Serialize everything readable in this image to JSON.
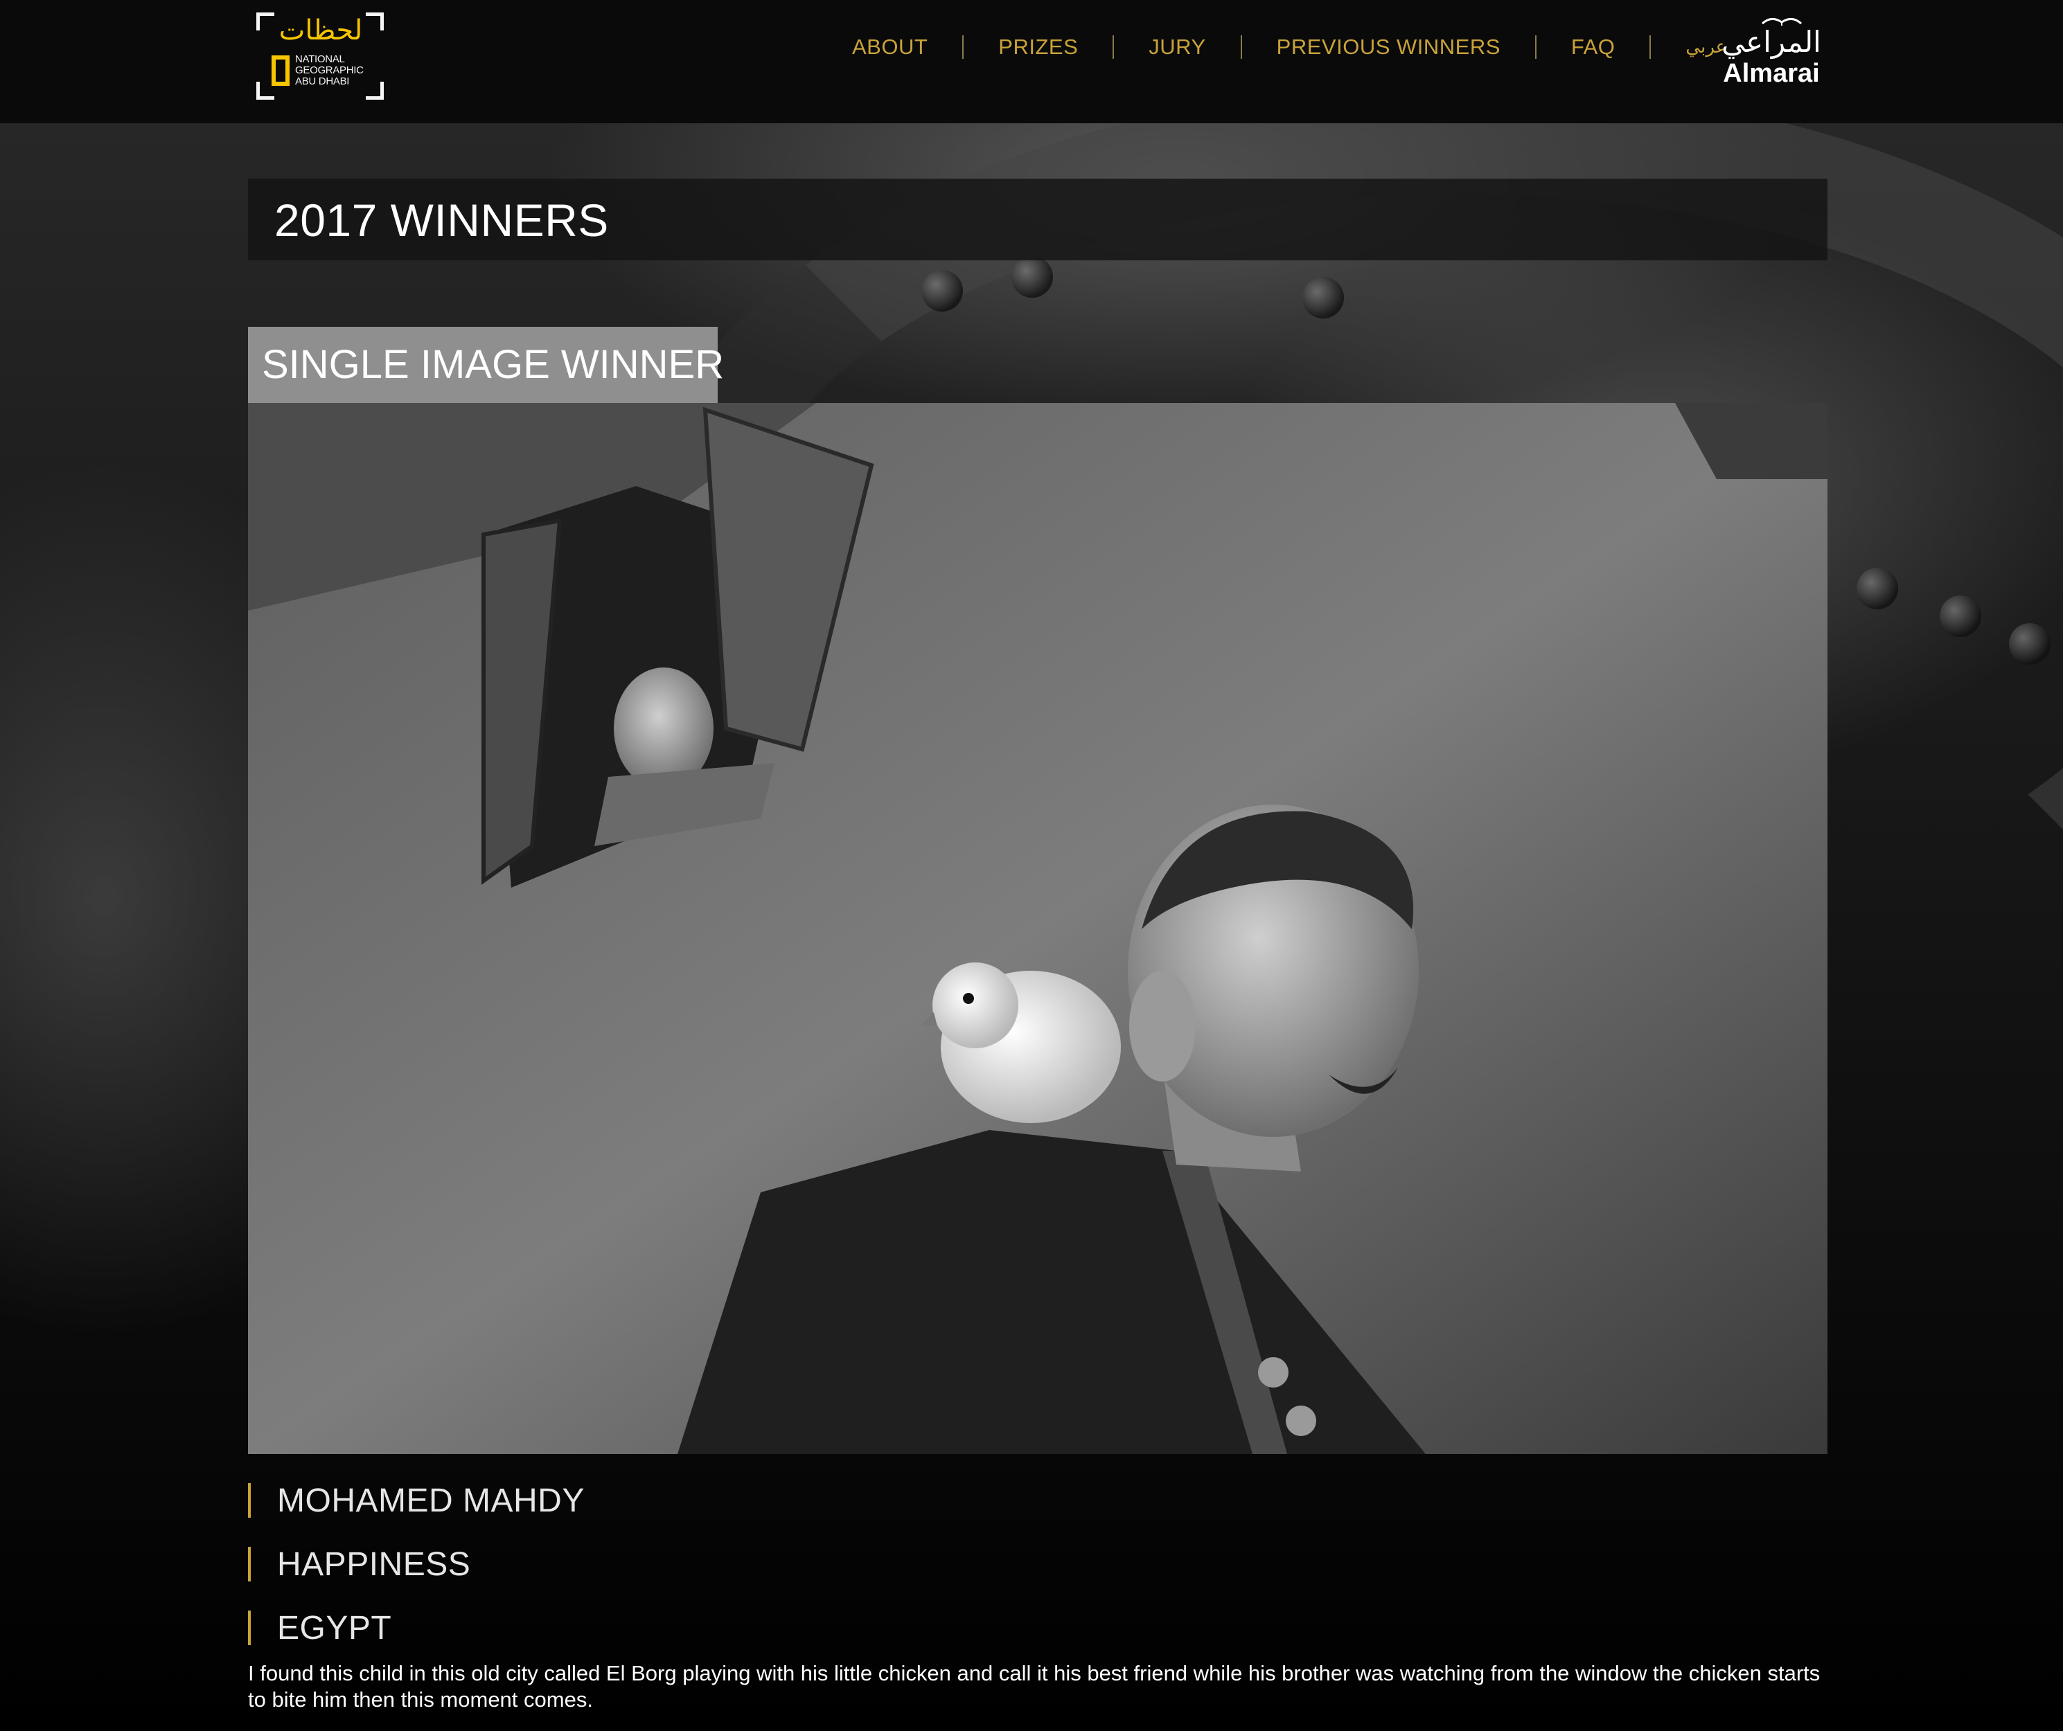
{
  "header": {
    "logo": {
      "arabic": "لحظات",
      "brand_lines": [
        "NATIONAL",
        "GEOGRAPHIC",
        "ABU DHABI"
      ]
    },
    "nav": [
      {
        "label": "ABOUT"
      },
      {
        "label": "PRIZES"
      },
      {
        "label": "JURY"
      },
      {
        "label": "PREVIOUS WINNERS"
      },
      {
        "label": "FAQ"
      },
      {
        "label": "عربي"
      }
    ],
    "sponsor": {
      "arabic": "المراعي",
      "name": "Almarai"
    }
  },
  "main": {
    "page_title": "2017 WINNERS",
    "section_label": "SINGLE IMAGE WINNER",
    "winner": {
      "photographer": "MOHAMED MAHDY",
      "title": "HAPPINESS",
      "country": "EGYPT",
      "description": "I found this child in this old city called El Borg playing with his little chicken and call it his best friend while his brother was watching from the window the chicken starts to bite him then this moment comes."
    }
  },
  "colors": {
    "accent": "#c9a33a",
    "logo_yellow": "#f7c600",
    "header_bg": "#0a0a0a",
    "section_tab_bg": "#8f8f8f"
  }
}
